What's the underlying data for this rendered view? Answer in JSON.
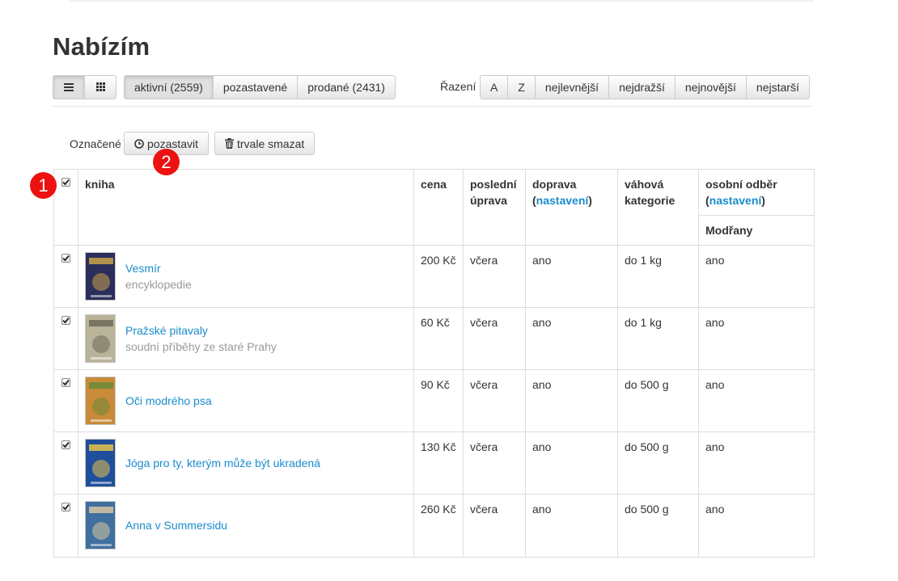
{
  "page": {
    "title": "Nabízím"
  },
  "view_toggle": [
    {
      "icon": "list-view-icon",
      "active": true
    },
    {
      "icon": "grid-view-icon",
      "active": false
    }
  ],
  "status_tabs": [
    {
      "label": "aktivní (2559)",
      "active": true
    },
    {
      "label": "pozastavené",
      "active": false
    },
    {
      "label": "prodané (2431)",
      "active": false
    }
  ],
  "sort": {
    "label": "Řazení",
    "options": [
      "A",
      "Z",
      "nejlevnější",
      "nejdražší",
      "nejnovější",
      "nejstarší"
    ]
  },
  "bulk": {
    "label": "Označené",
    "pause_label": "pozastavit",
    "pause_icon": "clock-icon",
    "delete_label": "trvale smazat",
    "delete_icon": "trash-icon"
  },
  "badges": [
    "1",
    "2"
  ],
  "table": {
    "headers": {
      "book": "kniha",
      "price": "cena",
      "last_edit": "poslední úprava",
      "shipping": "doprava",
      "shipping_link": "nastavení",
      "weight": "váhová kategorie",
      "pickup": "osobní odběr",
      "pickup_link": "nastavení",
      "pickup_location": "Modřany"
    },
    "rows": [
      {
        "title": "Vesmír",
        "subtitle": "encyklopedie",
        "price": "200 Kč",
        "edited": "včera",
        "shipping": "ano",
        "weight": "do 1 kg",
        "pickup": "ano",
        "cover_color": "#2b2e5a",
        "cover_accent": "#c9a24a"
      },
      {
        "title": "Pražské pitavaly",
        "subtitle": "soudní příběhy ze staré Prahy",
        "price": "60 Kč",
        "edited": "včera",
        "shipping": "ano",
        "weight": "do 1 kg",
        "pickup": "ano",
        "cover_color": "#b9b39a",
        "cover_accent": "#6e6a58"
      },
      {
        "title": "Oči modrého psa",
        "subtitle": "",
        "price": "90 Kč",
        "edited": "včera",
        "shipping": "ano",
        "weight": "do 500 g",
        "pickup": "ano",
        "cover_color": "#c98a3a",
        "cover_accent": "#6b8a3a"
      },
      {
        "title": "Jóga pro ty, kterým může být ukradená",
        "subtitle": "",
        "price": "130 Kč",
        "edited": "včera",
        "shipping": "ano",
        "weight": "do 500 g",
        "pickup": "ano",
        "cover_color": "#1f4f9a",
        "cover_accent": "#e8c34a"
      },
      {
        "title": "Anna v Summersidu",
        "subtitle": "",
        "price": "260 Kč",
        "edited": "včera",
        "shipping": "ano",
        "weight": "do 500 g",
        "pickup": "ano",
        "cover_color": "#3f6f9e",
        "cover_accent": "#d9c6a0"
      }
    ]
  }
}
